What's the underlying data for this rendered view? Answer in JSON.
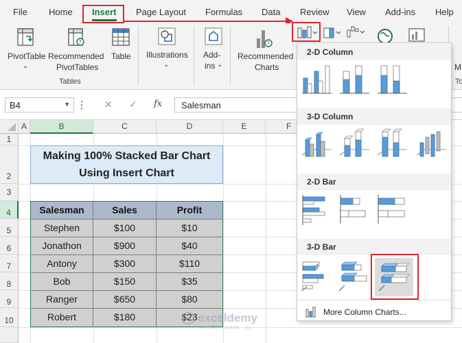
{
  "menu": {
    "tabs": [
      "File",
      "Home",
      "Insert",
      "Page Layout",
      "Formulas",
      "Data",
      "Review",
      "View",
      "Add-ins",
      "Help"
    ],
    "active_tab": "Insert"
  },
  "ribbon": {
    "pivottable_label": "PivotTable",
    "recommended_pivottables_label": [
      "Recommended",
      "PivotTables"
    ],
    "table_label": "Table",
    "illustrations_label": "Illustrations",
    "addins_label": [
      "Add-",
      "ins"
    ],
    "recommended_charts_label": [
      "Recommended",
      "Charts"
    ],
    "tables_group_label": "Tables",
    "dropdown_arrow": "⌄",
    "cut_right_label_1": "M",
    "cut_right_label_2": "To"
  },
  "formula_bar": {
    "namebox": "B4",
    "fx_label": "fx",
    "cancel_icon": "✕",
    "enter_icon": "✓",
    "value": "Salesman"
  },
  "grid": {
    "columns": [
      "A",
      "B",
      "C",
      "D",
      "E",
      "F"
    ],
    "rows": [
      "1",
      "2",
      "3",
      "4",
      "5",
      "6",
      "7",
      "8",
      "9",
      "10"
    ],
    "title": [
      "Making 100% Stacked Bar Chart",
      "Using Insert Chart"
    ],
    "table": {
      "headers": [
        "Salesman",
        "Sales",
        "Profit"
      ],
      "rows": [
        [
          "Stephen",
          "$100",
          "$10"
        ],
        [
          "Jonathon",
          "$900",
          "$40"
        ],
        [
          "Antony",
          "$300",
          "$110"
        ],
        [
          "Bob",
          "$150",
          "$35"
        ],
        [
          "Ranger",
          "$650",
          "$80"
        ],
        [
          "Robert",
          "$180",
          "$23"
        ]
      ]
    }
  },
  "chart_dropdown": {
    "sections": [
      "2-D Column",
      "3-D Column",
      "2-D Bar",
      "3-D Bar"
    ],
    "more_label": "More Column Charts...",
    "more_underline_char": "M"
  },
  "watermark": {
    "name": "exceldemy",
    "tagline": "EXCEL · DATA · BI"
  },
  "colors": {
    "accent_green": "#217346",
    "highlight_red": "#e0242b",
    "chart_blue": "#5b9bd5"
  }
}
